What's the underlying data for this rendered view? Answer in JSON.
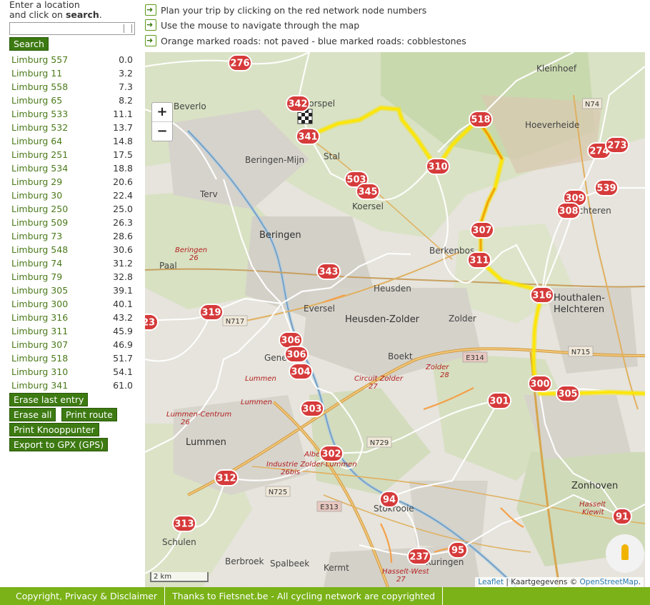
{
  "sidebar": {
    "intro_line1": "Enter a location",
    "intro_line2_pre": "and click on ",
    "intro_line2_bold": "search",
    "intro_line2_post": ".",
    "search_button": "Search",
    "routes": [
      {
        "name": "Limburg 557",
        "dist": "0.0"
      },
      {
        "name": "Limburg 11",
        "dist": "3.2"
      },
      {
        "name": "Limburg 558",
        "dist": "7.3"
      },
      {
        "name": "Limburg 65",
        "dist": "8.2"
      },
      {
        "name": "Limburg 533",
        "dist": "11.1"
      },
      {
        "name": "Limburg 532",
        "dist": "13.7"
      },
      {
        "name": "Limburg 64",
        "dist": "14.8"
      },
      {
        "name": "Limburg 251",
        "dist": "17.5"
      },
      {
        "name": "Limburg 534",
        "dist": "18.8"
      },
      {
        "name": "Limburg 29",
        "dist": "20.6"
      },
      {
        "name": "Limburg 30",
        "dist": "22.4"
      },
      {
        "name": "Limburg 250",
        "dist": "25.0"
      },
      {
        "name": "Limburg 509",
        "dist": "26.3"
      },
      {
        "name": "Limburg 73",
        "dist": "28.6"
      },
      {
        "name": "Limburg 548",
        "dist": "30.6"
      },
      {
        "name": "Limburg 74",
        "dist": "31.2"
      },
      {
        "name": "Limburg 79",
        "dist": "32.8"
      },
      {
        "name": "Limburg 305",
        "dist": "39.1"
      },
      {
        "name": "Limburg 300",
        "dist": "40.1"
      },
      {
        "name": "Limburg 316",
        "dist": "43.2"
      },
      {
        "name": "Limburg 311",
        "dist": "45.9"
      },
      {
        "name": "Limburg 307",
        "dist": "46.9"
      },
      {
        "name": "Limburg 518",
        "dist": "51.7"
      },
      {
        "name": "Limburg 310",
        "dist": "54.1"
      },
      {
        "name": "Limburg 341",
        "dist": "61.0"
      }
    ],
    "buttons": {
      "erase_last": "Erase last entry",
      "erase_all": "Erase all",
      "print_route": "Print route",
      "print_knooppunter": "Print Knooppunter",
      "export_gpx": "Export to GPX (GPS)"
    }
  },
  "notes": [
    "Plan your trip by clicking on the red network node numbers",
    "Use the mouse to navigate through the map",
    "Orange marked roads: not paved - blue marked roads: cobblestones"
  ],
  "map": {
    "zoom_in": "+",
    "zoom_out": "−",
    "scale": "2 km",
    "attrib_leaflet": "Leaflet",
    "attrib_mid": " | Kaartgegevens © ",
    "attrib_osm": "OpenStreetMap",
    "attrib_end": ".",
    "nodes": [
      "276",
      "342",
      "341",
      "518",
      "310",
      "274",
      "273",
      "503",
      "345",
      "539",
      "309",
      "308",
      "307",
      "311",
      "343",
      "316",
      "319",
      "23",
      "306",
      "306",
      "304",
      "303",
      "300",
      "305",
      "301",
      "302",
      "312",
      "313",
      "94",
      "237",
      "95",
      "91"
    ],
    "places": [
      "Beverlo",
      "Korspel",
      "Stal",
      "Beringen-Mijn",
      "Koersel",
      "Beringen",
      "Paal",
      "Berkenbos",
      "Heusden",
      "Heusden-Zolder",
      "Zolder",
      "Eversel",
      "Genebos",
      "Boekt",
      "Houthalen-Helchteren",
      "Zonhoven",
      "Lummen",
      "Schulen",
      "Berbroek",
      "Spalbeek",
      "Kermt",
      "Kuringen",
      "Stokrooie",
      "Kleinhoef",
      "Hoeverheide",
      "Helchteren",
      "Terv"
    ],
    "roads": [
      "N74",
      "N717",
      "E314",
      "N715",
      "N729",
      "N725",
      "E313"
    ],
    "red_labels": [
      "Beringen 26",
      "Lummen",
      "Lummen",
      "Lummen-Centrum 26",
      "Circuit Zolder 27",
      "Zolder 28",
      "Industrie Zolder-Lummen 26bis",
      "Hasselt-West 27",
      "Albe",
      "Hasselt Kiewit"
    ]
  },
  "footer": {
    "copyright": "Copyright, Privacy & Disclaimer",
    "thanks": "Thanks to Fietsnet.be - All cycling network are copyrighted"
  },
  "colors": {
    "button_green": "#3d7a12",
    "footer_green": "#7ab217",
    "node_red": "#d63a3a",
    "route_yellow": "#f5e400"
  }
}
